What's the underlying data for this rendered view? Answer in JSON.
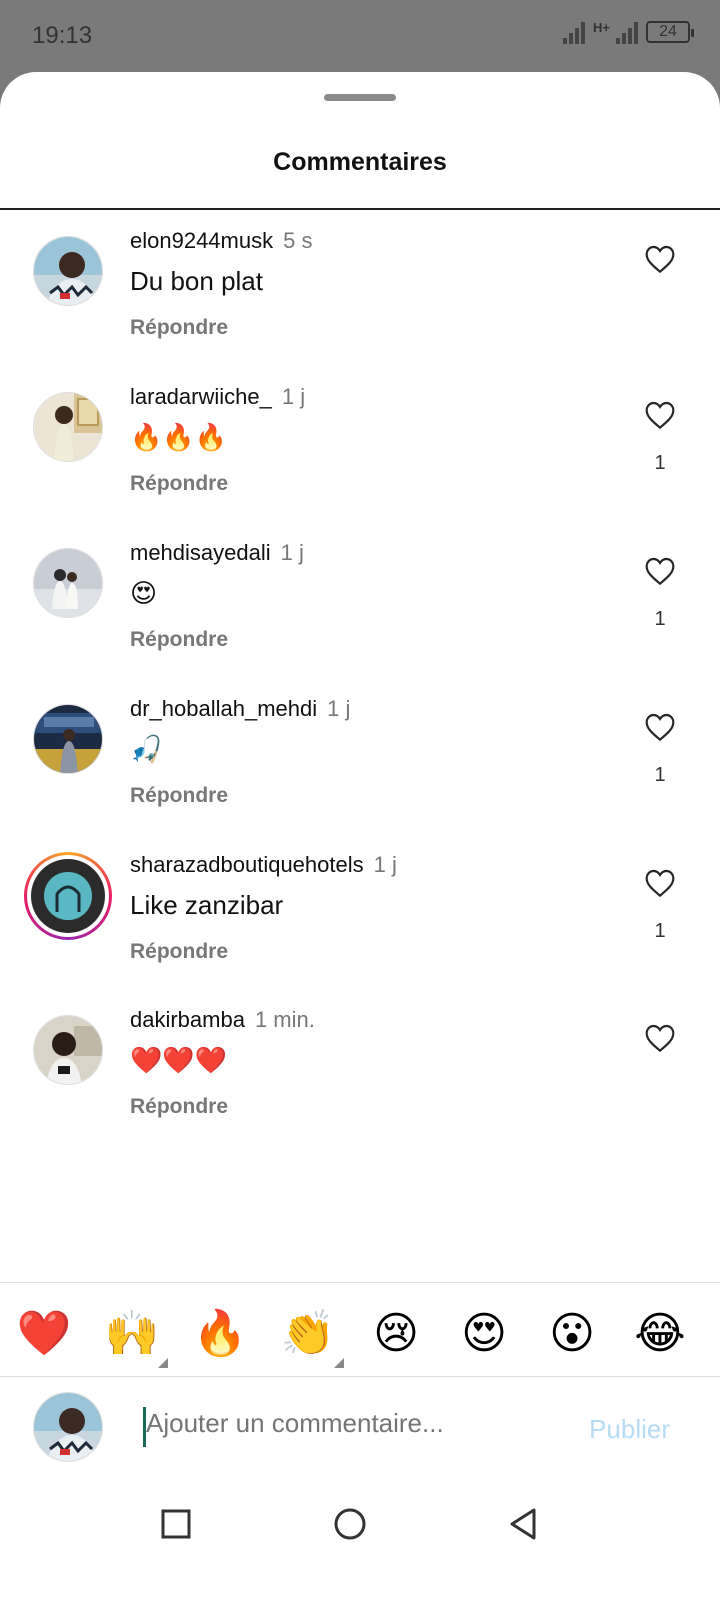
{
  "status_bar": {
    "time": "19:13",
    "network": "H+",
    "battery": "24"
  },
  "sheet": {
    "title": "Commentaires"
  },
  "comments": [
    {
      "username": "elon9244musk",
      "time": "5 s",
      "text": "Du bon plat",
      "reply": "Répondre",
      "likes": ""
    },
    {
      "username": "laradarwiiche_",
      "time": "1 j",
      "text": "🔥🔥🔥",
      "reply": "Répondre",
      "likes": "1"
    },
    {
      "username": "mehdisayedali",
      "time": "1 j",
      "text": "😍",
      "reply": "Répondre",
      "likes": "1"
    },
    {
      "username": "dr_hoballah_mehdi",
      "time": "1 j",
      "text": "🎣",
      "reply": "Répondre",
      "likes": "1"
    },
    {
      "username": "sharazadboutiquehotels",
      "time": "1 j",
      "text": "Like zanzibar",
      "reply": "Répondre",
      "likes": "1"
    },
    {
      "username": "dakirbamba",
      "time": "1 min.",
      "text": "❤️❤️❤️",
      "reply": "Répondre",
      "likes": ""
    }
  ],
  "emoji_bar": [
    "❤️",
    "🙌",
    "🔥",
    "👏",
    "😢",
    "😍",
    "😮",
    "😂"
  ],
  "composer": {
    "placeholder": "Ajouter un commentaire...",
    "publish_label": "Publier"
  },
  "colors": {
    "accent": "#b5dcf4",
    "like_outline": "#262626"
  }
}
